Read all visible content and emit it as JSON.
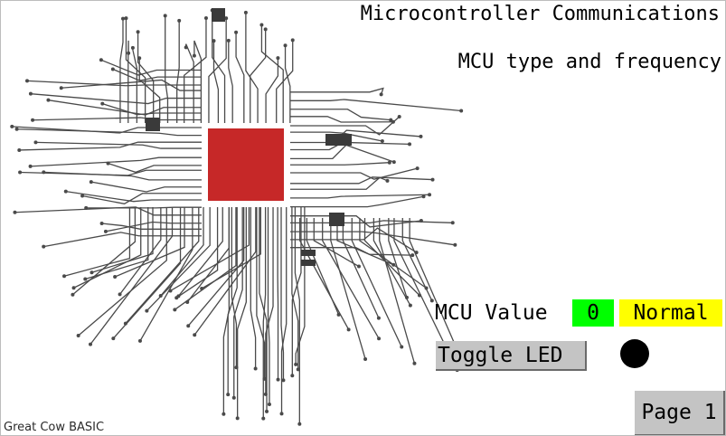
{
  "header": {
    "title": "Microcontroller Communications",
    "subtitle": "MCU type and frequency"
  },
  "mcu": {
    "label": "MCU Value",
    "value": "0",
    "status": "Normal"
  },
  "controls": {
    "toggle_label": "Toggle LED",
    "page_label": "Page 1"
  },
  "footer": {
    "brand": "Great Cow BASIC"
  },
  "indicators": {
    "led_state": "off"
  },
  "colors": {
    "chip": "#c62828",
    "value_bg": "#00ff00",
    "status_bg": "#ffff00",
    "button_bg": "#c4c4c4",
    "led": "#000000",
    "trace": "#4a4a4a"
  }
}
